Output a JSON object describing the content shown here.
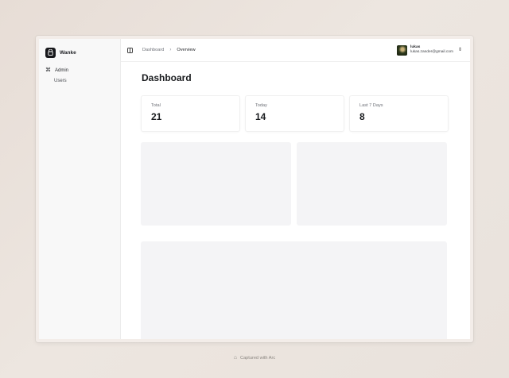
{
  "app": {
    "name": "Wanke"
  },
  "sidebar": {
    "items": [
      {
        "label": "Admin",
        "icon": "command-icon"
      },
      {
        "label": "Users"
      }
    ]
  },
  "topbar": {
    "breadcrumb": [
      "Dashboard",
      "Overview"
    ],
    "user": {
      "name": "lukas",
      "email": "lukas.zander@gmail.com"
    }
  },
  "main": {
    "title": "Dashboard",
    "stats": [
      {
        "label": "Total",
        "value": "21"
      },
      {
        "label": "Today",
        "value": "14"
      },
      {
        "label": "Last 7 Days",
        "value": "8"
      }
    ]
  },
  "footer": {
    "text": "Captured with Arc"
  },
  "colors": {
    "accent": "#17181b",
    "background": "#e9e2dc",
    "placeholder": "#f4f4f6"
  }
}
